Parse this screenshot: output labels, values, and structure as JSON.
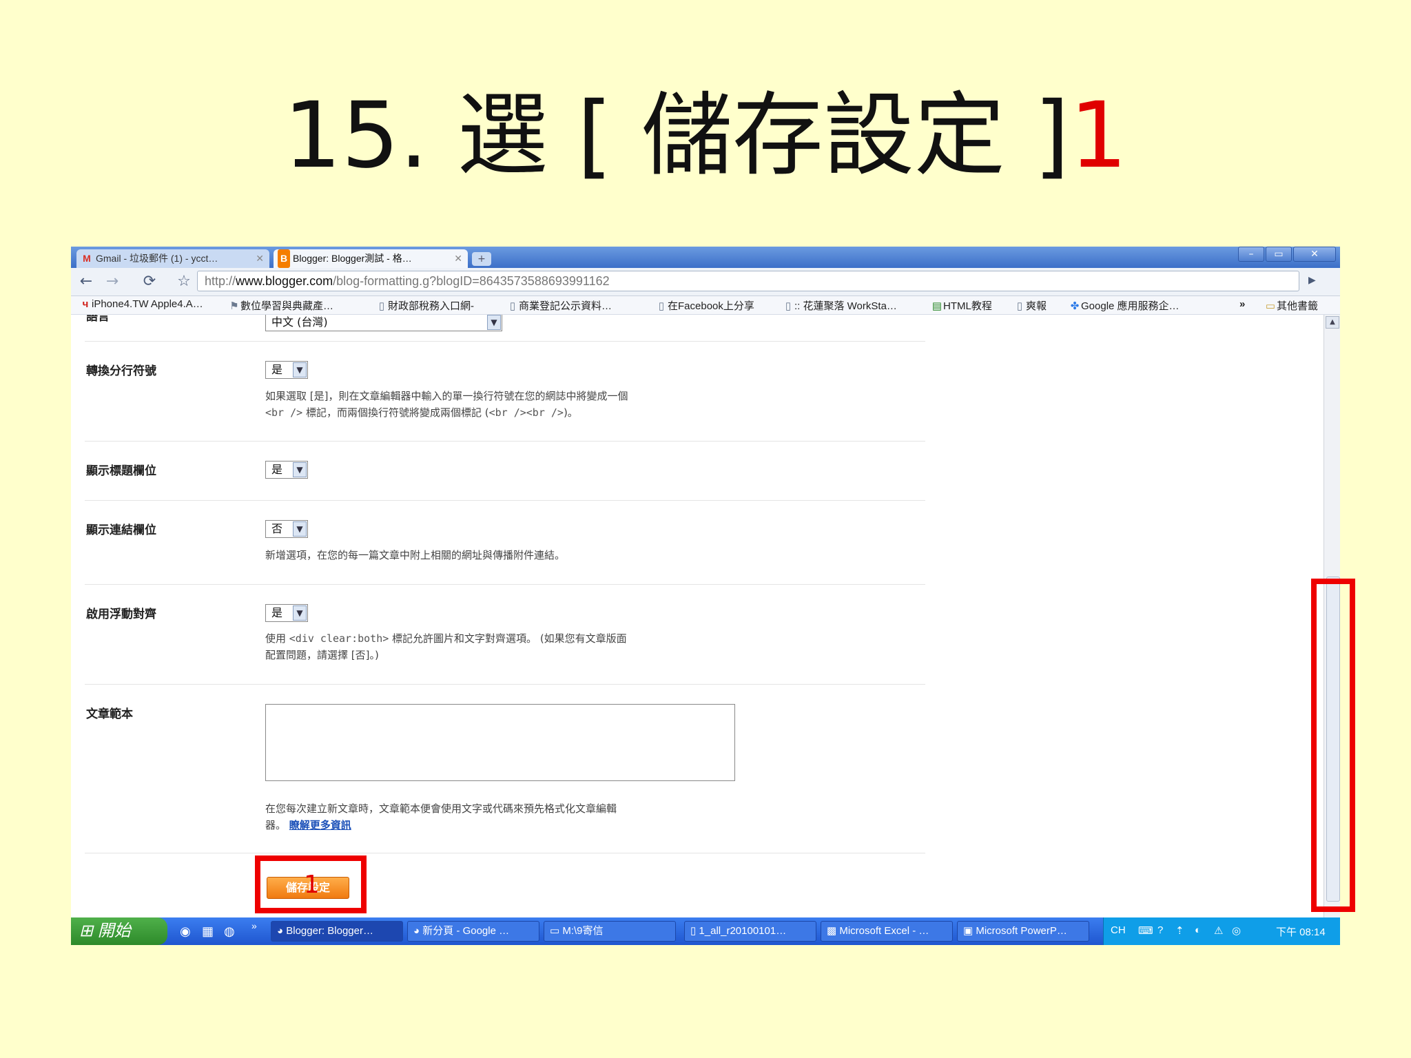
{
  "slide": {
    "title_prefix": "15. 選 [ 儲存設定 ]",
    "title_suffix": "1"
  },
  "browser": {
    "tabs": [
      {
        "icon": "gmail-icon",
        "label": "Gmail - 垃圾郵件 (1) - ycct…",
        "active": false
      },
      {
        "icon": "blogger-icon",
        "label": "Blogger: Blogger測試 - 格…",
        "active": true
      }
    ],
    "newtab": "+",
    "window_buttons": [
      "–",
      "▭",
      "✕"
    ],
    "url_prefix": "http://",
    "url_domain": "www.blogger.com",
    "url_path": "/blog-formatting.g?blogID=8643573588693991162",
    "bookmarks": [
      "iPhone4.TW Apple4.A…",
      "數位學習與典藏產…",
      "財政部稅務入口網-",
      "商業登記公示資料…",
      "在Facebook上分享",
      ":: 花蓮聚落 WorkSta…",
      "HTML教程",
      "爽報",
      "Google 應用服務企…"
    ],
    "bookmarks_more": "»",
    "other_bookmarks": "其他書籤"
  },
  "form": {
    "language_label": "語言",
    "language_value": "中文 (台灣)",
    "convert_breaks": {
      "label": "轉換分行符號",
      "value": "是",
      "help1": "如果選取 [是]，則在文章編輯器中輸入的單一換行符號在您的網誌中將變成一個",
      "help2a": "<br />",
      "help2b": " 標記，而兩個換行符號將變成兩個標記 (",
      "help2c": "<br /><br />",
      "help2d": ")。"
    },
    "show_title": {
      "label": "顯示標題欄位",
      "value": "是"
    },
    "show_link": {
      "label": "顯示連結欄位",
      "value": "否",
      "help": "新增選項，在您的每一篇文章中附上相關的網址與傳播附件連結。"
    },
    "float_align": {
      "label": "啟用浮動對齊",
      "value": "是",
      "help1a": "使用 ",
      "help1b": "<div clear:both>",
      "help1c": " 標記允許圖片和文字對齊選項。 (如果您有文章版面",
      "help2": "配置問題，請選擇 [否]。)"
    },
    "post_template": {
      "label": "文章範本",
      "help1": "在您每次建立新文章時，文章範本便會使用文字或代碼來預先格式化文章編輯",
      "help2": "器。",
      "link": "瞭解更多資訊"
    },
    "save_button": "儲存設定",
    "step_marker": "1"
  },
  "taskbar": {
    "start": "開始",
    "tasks": [
      "Blogger: Blogger…",
      "新分頁 - Google …",
      "M:\\9寄信",
      "1_all_r20100101…",
      "Microsoft Excel - …",
      "Microsoft PowerP…"
    ],
    "lang": "CH",
    "clock": "下午 08:14"
  },
  "colors": {
    "slide_bg": "#ffffcc",
    "annotation": "#ee0000",
    "save_button": "#f07a10"
  }
}
